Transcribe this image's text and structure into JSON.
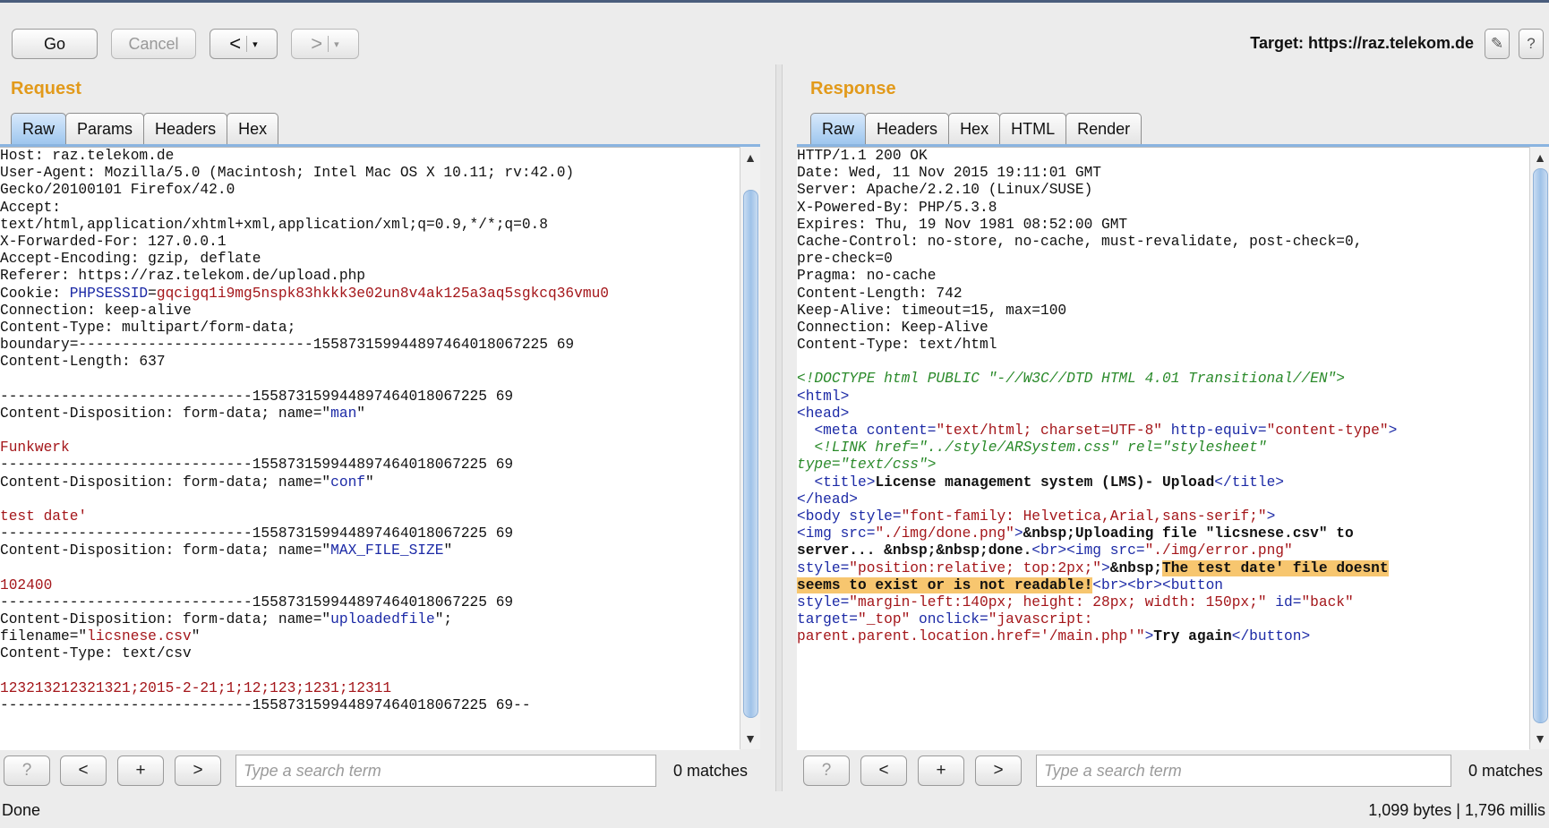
{
  "toolbar": {
    "go_label": "Go",
    "cancel_label": "Cancel",
    "back_arrow": "<",
    "forward_arrow": ">",
    "caret": "▾",
    "target_text": "Target: https://raz.telekom.de",
    "edit_icon": "✎",
    "help_icon": "?"
  },
  "request": {
    "title": "Request",
    "tabs": [
      "Raw",
      "Params",
      "Headers",
      "Hex"
    ],
    "active_tab": "Raw",
    "lines": [
      [
        {
          "t": "Host: raz.telekom.de"
        }
      ],
      [
        {
          "t": "User-Agent: Mozilla/5.0 (Macintosh; Intel Mac OS X 10.11; rv:42.0)"
        }
      ],
      [
        {
          "t": "Gecko/20100101 Firefox/42.0"
        }
      ],
      [
        {
          "t": "Accept:"
        }
      ],
      [
        {
          "t": "text/html,application/xhtml+xml,application/xml;q=0.9,*/*;q=0.8"
        }
      ],
      [
        {
          "t": "X-Forwarded-For: 127.0.0.1"
        }
      ],
      [
        {
          "t": "Accept-Encoding: gzip, deflate"
        }
      ],
      [
        {
          "t": "Referer: https://raz.telekom.de/upload.php"
        }
      ],
      [
        {
          "t": "Cookie: "
        },
        {
          "t": "PHPSESSID",
          "c": "blue"
        },
        {
          "t": "="
        },
        {
          "t": "gqcigq1i9mg5nspk83hkkk3e02un8v4ak125a3aq5sgkcq36vmu0",
          "c": "red"
        }
      ],
      [
        {
          "t": "Connection: keep-alive"
        }
      ],
      [
        {
          "t": "Content-Type: multipart/form-data;"
        }
      ],
      [
        {
          "t": "boundary=---------------------------155873159944897464018067225 69"
        }
      ],
      [
        {
          "t": "Content-Length: 637"
        }
      ],
      [
        {
          "t": ""
        }
      ],
      [
        {
          "t": "-----------------------------155873159944897464018067225 69"
        }
      ],
      [
        {
          "t": "Content-Disposition: form-data; name=\""
        },
        {
          "t": "man",
          "c": "blue"
        },
        {
          "t": "\""
        }
      ],
      [
        {
          "t": ""
        }
      ],
      [
        {
          "t": "Funkwerk",
          "c": "red"
        }
      ],
      [
        {
          "t": "-----------------------------155873159944897464018067225 69"
        }
      ],
      [
        {
          "t": "Content-Disposition: form-data; name=\""
        },
        {
          "t": "conf",
          "c": "blue"
        },
        {
          "t": "\""
        }
      ],
      [
        {
          "t": ""
        }
      ],
      [
        {
          "t": "test date'",
          "c": "red"
        }
      ],
      [
        {
          "t": "-----------------------------155873159944897464018067225 69"
        }
      ],
      [
        {
          "t": "Content-Disposition: form-data; name=\""
        },
        {
          "t": "MAX_FILE_SIZE",
          "c": "blue"
        },
        {
          "t": "\""
        }
      ],
      [
        {
          "t": ""
        }
      ],
      [
        {
          "t": "102400",
          "c": "red"
        }
      ],
      [
        {
          "t": "-----------------------------155873159944897464018067225 69"
        }
      ],
      [
        {
          "t": "Content-Disposition: form-data; name=\""
        },
        {
          "t": "uploadedfile",
          "c": "blue"
        },
        {
          "t": "\";"
        }
      ],
      [
        {
          "t": "filename=\""
        },
        {
          "t": "licsnese.csv",
          "c": "red"
        },
        {
          "t": "\""
        }
      ],
      [
        {
          "t": "Content-Type: text/csv"
        }
      ],
      [
        {
          "t": ""
        }
      ],
      [
        {
          "t": "123213212321321;2015-2-21;1;12;123;1231;12311",
          "c": "red"
        }
      ],
      [
        {
          "t": "-----------------------------155873159944897464018067225 69--"
        }
      ]
    ],
    "search_placeholder": "Type a search term",
    "matches": "0 matches"
  },
  "response": {
    "title": "Response",
    "tabs": [
      "Raw",
      "Headers",
      "Hex",
      "HTML",
      "Render"
    ],
    "active_tab": "Raw",
    "lines": [
      [
        {
          "t": "HTTP/1.1 200 OK"
        }
      ],
      [
        {
          "t": "Date: Wed, 11 Nov 2015 19:11:01 GMT"
        }
      ],
      [
        {
          "t": "Server: Apache/2.2.10 (Linux/SUSE)"
        }
      ],
      [
        {
          "t": "X-Powered-By: PHP/5.3.8"
        }
      ],
      [
        {
          "t": "Expires: Thu, 19 Nov 1981 08:52:00 GMT"
        }
      ],
      [
        {
          "t": "Cache-Control: no-store, no-cache, must-revalidate, post-check=0,"
        }
      ],
      [
        {
          "t": "pre-check=0"
        }
      ],
      [
        {
          "t": "Pragma: no-cache"
        }
      ],
      [
        {
          "t": "Content-Length: 742"
        }
      ],
      [
        {
          "t": "Keep-Alive: timeout=15, max=100"
        }
      ],
      [
        {
          "t": "Connection: Keep-Alive"
        }
      ],
      [
        {
          "t": "Content-Type: text/html"
        }
      ],
      [
        {
          "t": ""
        }
      ],
      [
        {
          "t": "<!DOCTYPE html PUBLIC \"-//W3C//DTD HTML 4.01 Transitional//EN\">",
          "c": "green"
        }
      ],
      [
        {
          "t": "<html>",
          "c": "blue"
        }
      ],
      [
        {
          "t": "<head>",
          "c": "blue"
        }
      ],
      [
        {
          "t": "  "
        },
        {
          "t": "<meta ",
          "c": "blue"
        },
        {
          "t": "content=",
          "c": "blue"
        },
        {
          "t": "\"text/html; charset=UTF-8\"",
          "c": "red"
        },
        {
          "t": " http-equiv=",
          "c": "blue"
        },
        {
          "t": "\"content-type\"",
          "c": "red"
        },
        {
          "t": ">",
          "c": "blue"
        }
      ],
      [
        {
          "t": "  "
        },
        {
          "t": "<!LINK href=\"../style/ARSystem.css\" rel=\"stylesheet\"",
          "c": "green"
        }
      ],
      [
        {
          "t": "type=\"text/css\">",
          "c": "green"
        }
      ],
      [
        {
          "t": "  "
        },
        {
          "t": "<title>",
          "c": "blue"
        },
        {
          "t": "License management system (LMS)- Upload",
          "c": "bold"
        },
        {
          "t": "</title>",
          "c": "blue"
        }
      ],
      [
        {
          "t": "</head>",
          "c": "blue"
        }
      ],
      [
        {
          "t": "<body ",
          "c": "blue"
        },
        {
          "t": "style=",
          "c": "blue"
        },
        {
          "t": "\"font-family: Helvetica,Arial,sans-serif;\"",
          "c": "red"
        },
        {
          "t": ">",
          "c": "blue"
        }
      ],
      [
        {
          "t": "<img ",
          "c": "blue"
        },
        {
          "t": "src=",
          "c": "blue"
        },
        {
          "t": "\"./img/done.png\"",
          "c": "red"
        },
        {
          "t": ">",
          "c": "blue"
        },
        {
          "t": "&nbsp;Uploading file \"licsnese.csv\" to",
          "c": "bold"
        }
      ],
      [
        {
          "t": "server... &nbsp;&nbsp;done.",
          "c": "bold"
        },
        {
          "t": "<br><img ",
          "c": "blue"
        },
        {
          "t": "src=",
          "c": "blue"
        },
        {
          "t": "\"./img/error.png\"",
          "c": "red"
        }
      ],
      [
        {
          "t": "style=",
          "c": "blue"
        },
        {
          "t": "\"position:relative; top:2px;\"",
          "c": "red"
        },
        {
          "t": ">",
          "c": "blue"
        },
        {
          "t": "&nbsp;",
          "c": "bold"
        },
        {
          "t": "The test date' file doesnt",
          "c": "bold",
          "h": true
        }
      ],
      [
        {
          "t": "seems to exist or is not readable!",
          "c": "bold",
          "h": true
        },
        {
          "t": "<br><br><button",
          "c": "blue"
        }
      ],
      [
        {
          "t": "style=",
          "c": "blue"
        },
        {
          "t": "\"margin-left:140px; height: 28px; width: 150px;\"",
          "c": "red"
        },
        {
          "t": " id=",
          "c": "blue"
        },
        {
          "t": "\"back\"",
          "c": "red"
        }
      ],
      [
        {
          "t": "target=",
          "c": "blue"
        },
        {
          "t": "\"_top\"",
          "c": "red"
        },
        {
          "t": " onclick=",
          "c": "blue"
        },
        {
          "t": "\"javascript:",
          "c": "red"
        }
      ],
      [
        {
          "t": "parent.parent.location.href='/main.php'\"",
          "c": "red"
        },
        {
          "t": ">",
          "c": "blue"
        },
        {
          "t": "Try again",
          "c": "bold"
        },
        {
          "t": "</button>",
          "c": "blue"
        }
      ]
    ],
    "search_placeholder": "Type a search term",
    "matches": "0 matches"
  },
  "search_buttons": {
    "help": "?",
    "prev": "<",
    "add": "+",
    "next": ">"
  },
  "status": {
    "left": "Done",
    "right": "1,099 bytes | 1,796 millis"
  }
}
